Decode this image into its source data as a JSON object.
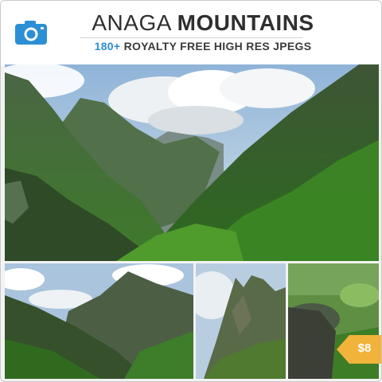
{
  "header": {
    "title_light": "ANAGA",
    "title_bold": "MOUNTAINS",
    "subtitle_count": "180+",
    "subtitle_rest": "ROYALTY FREE HIGH RES JPEGS",
    "icon": "camera-icon"
  },
  "price": {
    "label": "$8",
    "color": "#f1b33a"
  },
  "colors": {
    "accent": "#2b8fd6",
    "title": "#2f2f2f"
  }
}
